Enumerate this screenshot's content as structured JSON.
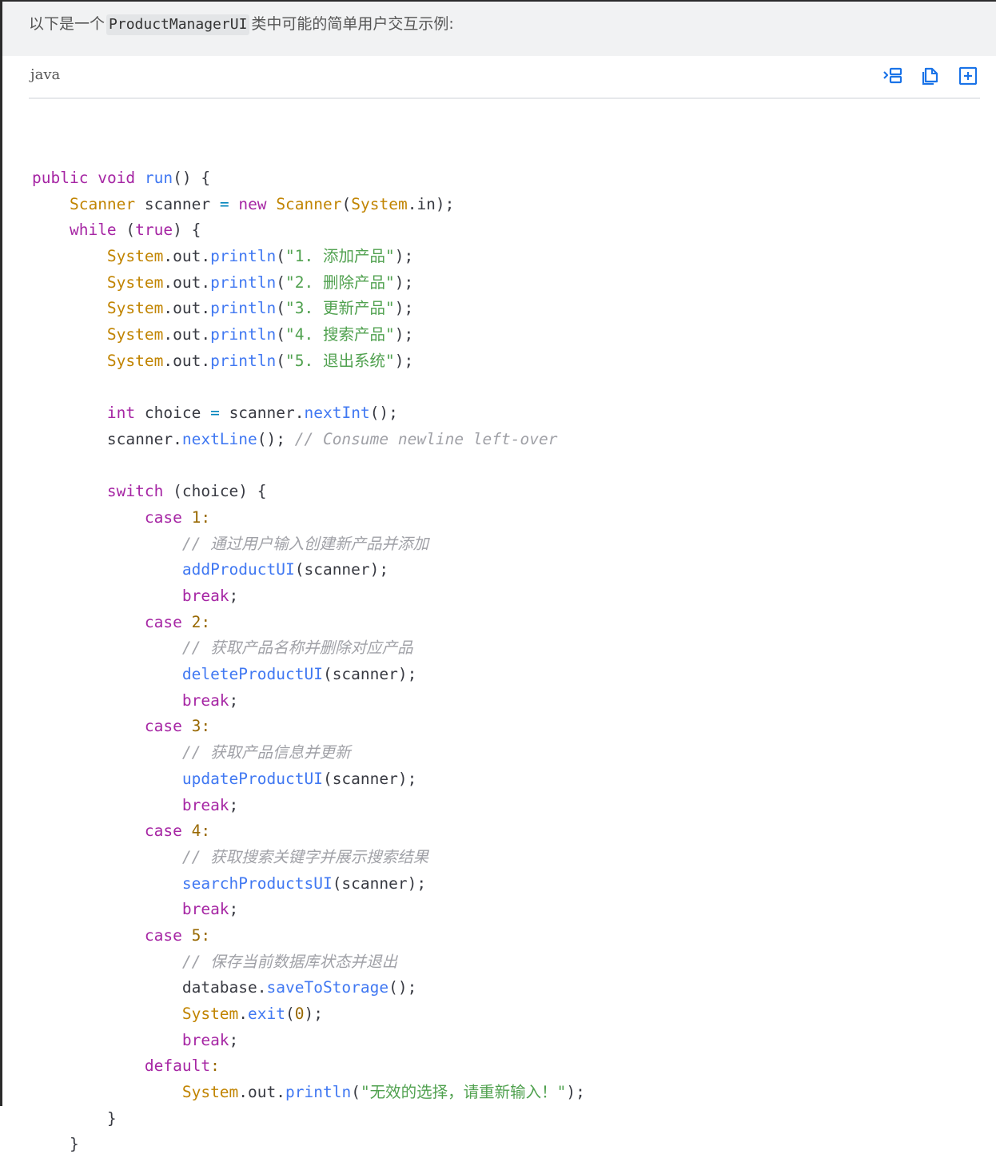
{
  "intro": {
    "before": "以下是一个",
    "code": "ProductManagerUI",
    "after": "类中可能的简单用户交互示例:"
  },
  "code_block": {
    "language": "java",
    "toolbar": {
      "wrap_icon": "wrap-lines-icon",
      "copy_icon": "copy-icon",
      "expand_icon": "expand-icon"
    },
    "lines": [
      "public void run() {",
      "    Scanner scanner = new Scanner(System.in);",
      "    while (true) {",
      "        System.out.println(\"1. 添加产品\");",
      "        System.out.println(\"2. 删除产品\");",
      "        System.out.println(\"3. 更新产品\");",
      "        System.out.println(\"4. 搜索产品\");",
      "        System.out.println(\"5. 退出系统\");",
      "",
      "        int choice = scanner.nextInt();",
      "        scanner.nextLine(); // Consume newline left-over",
      "",
      "        switch (choice) {",
      "            case 1:",
      "                // 通过用户输入创建新产品并添加",
      "                addProductUI(scanner);",
      "                break;",
      "            case 2:",
      "                // 获取产品名称并删除对应产品",
      "                deleteProductUI(scanner);",
      "                break;",
      "            case 3:",
      "                // 获取产品信息并更新",
      "                updateProductUI(scanner);",
      "                break;",
      "            case 4:",
      "                // 获取搜索关键字并展示搜索结果",
      "                searchProductsUI(scanner);",
      "                break;",
      "            case 5:",
      "                // 保存当前数据库状态并退出",
      "                database.saveToStorage();",
      "                System.exit(0);",
      "                break;",
      "            default:",
      "                System.out.println(\"无效的选择，请重新输入！\");",
      "        }",
      "    }"
    ]
  },
  "colors": {
    "keyword": "#a626a4",
    "type": "#c18401",
    "function": "#4078f2",
    "string": "#50a14f",
    "comment": "#a0a1a7",
    "number": "#986801",
    "toolbar_icon": "#1a73e8"
  }
}
